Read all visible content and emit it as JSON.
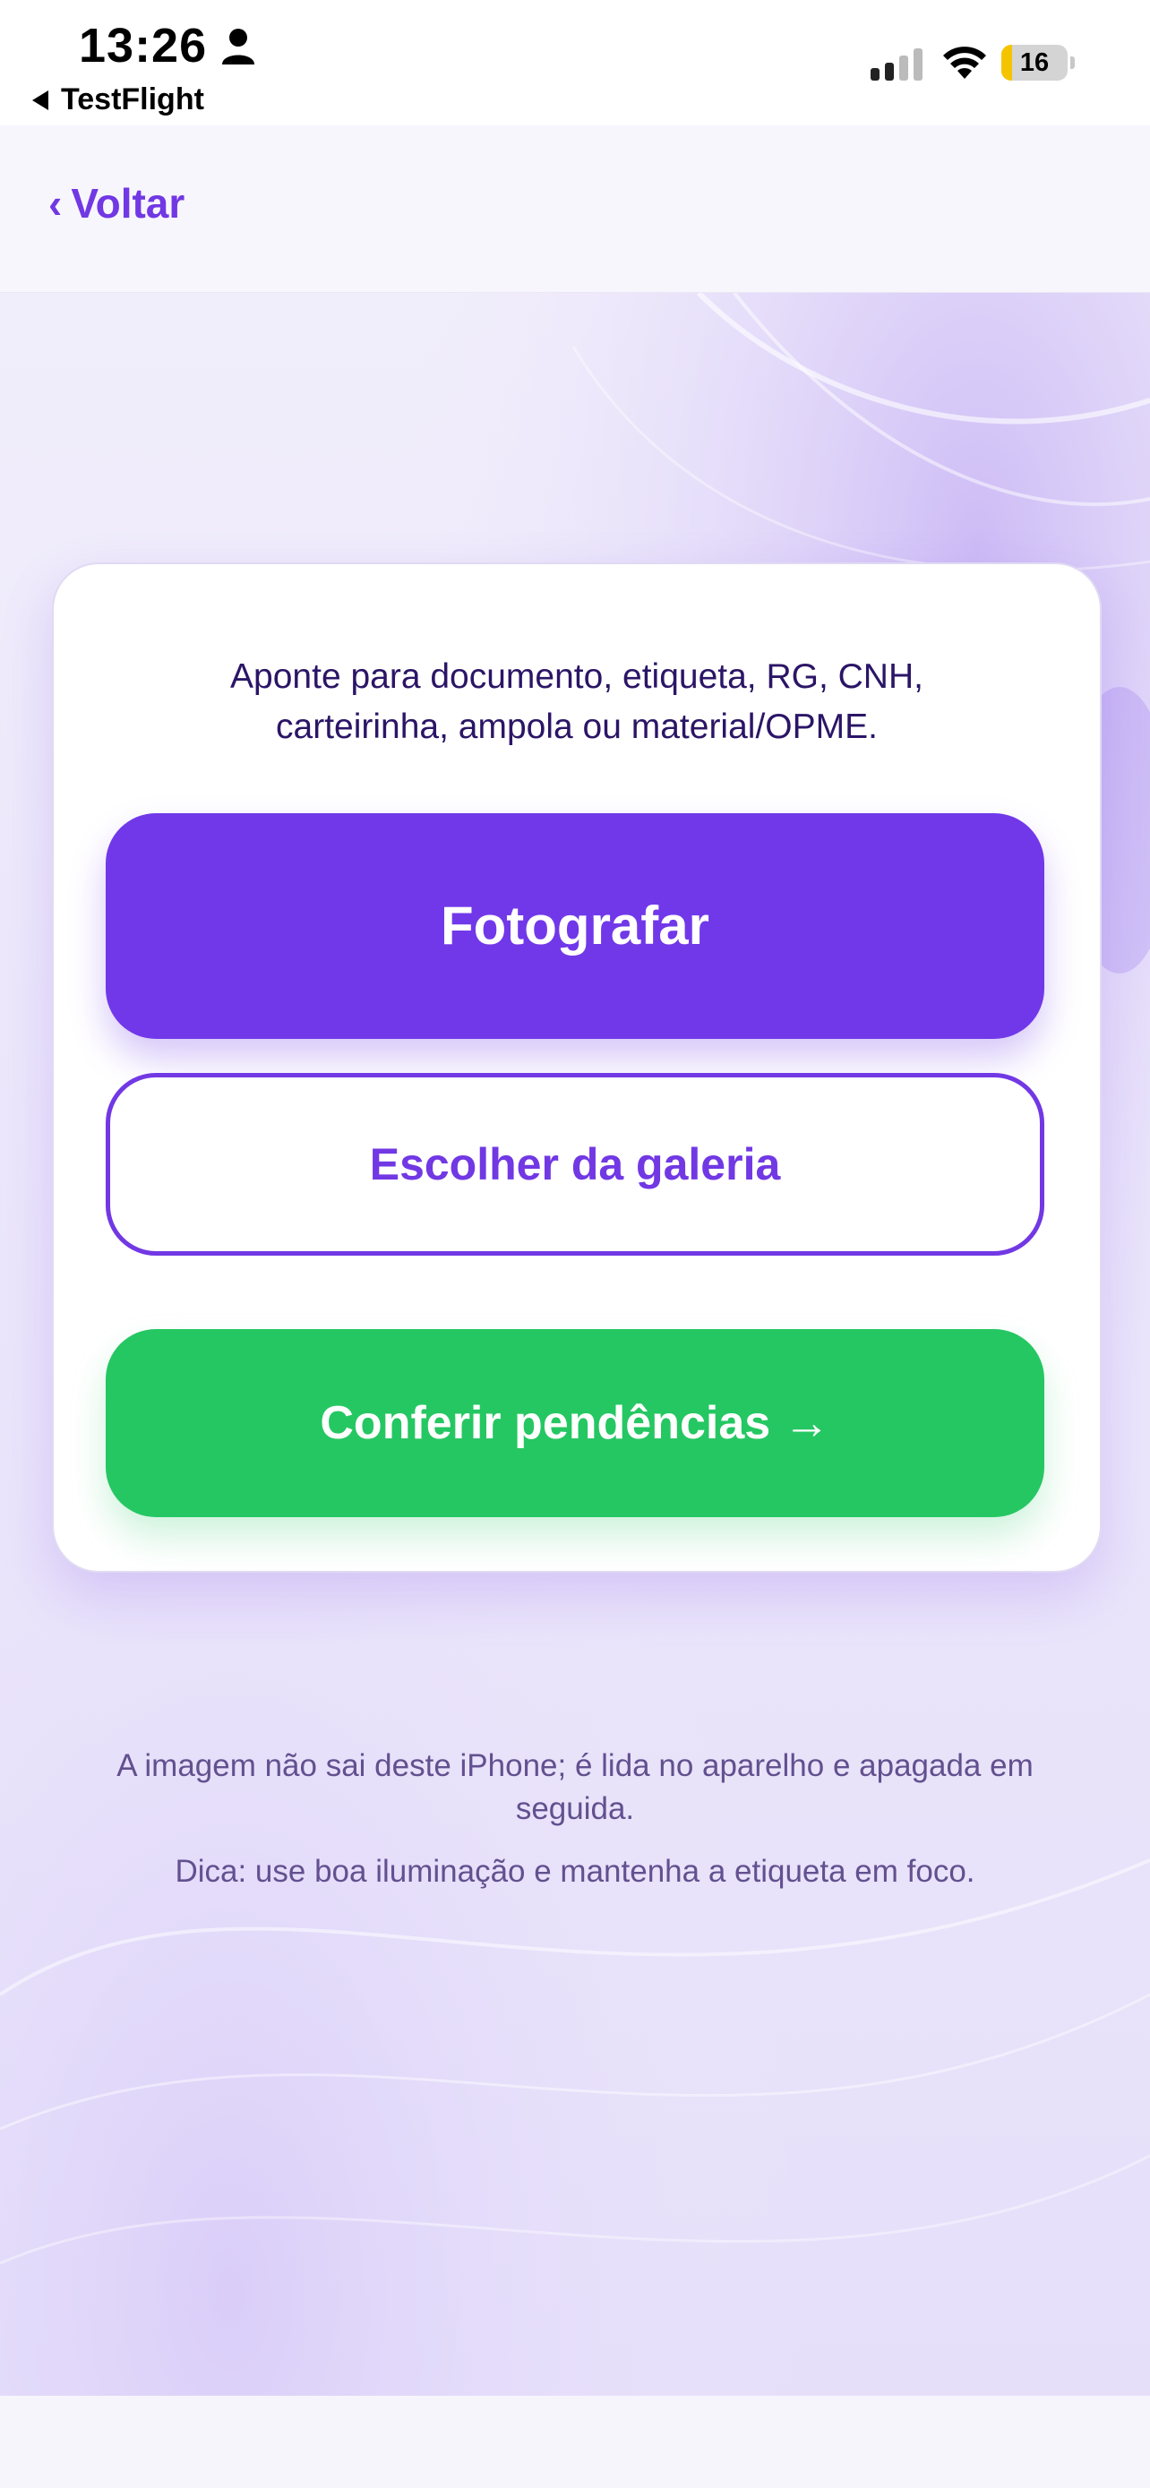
{
  "status_bar": {
    "time": "13:26",
    "back_app": "TestFlight",
    "battery_level": "16",
    "battery_fraction": 0.16,
    "battery_color": "#f5c400"
  },
  "nav": {
    "back_label": "Voltar",
    "back_icon": "chevron-left-icon",
    "accent_color": "#7138e4"
  },
  "card": {
    "instructions": "Aponte para documento, etiqueta, RG, CNH, carteirinha, ampola ou material/OPME.",
    "photo_button": "Fotografar",
    "gallery_button": "Escolher da galeria",
    "check_button": "Conferir pendências →"
  },
  "notes": {
    "privacy": "A imagem não sai deste iPhone; é lida no aparelho e apagada em seguida.",
    "tip": "Dica: use boa iluminação e mantenha a etiqueta em foco."
  },
  "colors": {
    "primary": "#7138e9",
    "success": "#25c762",
    "text_dark": "#2b1566",
    "text_muted": "#62508f"
  }
}
